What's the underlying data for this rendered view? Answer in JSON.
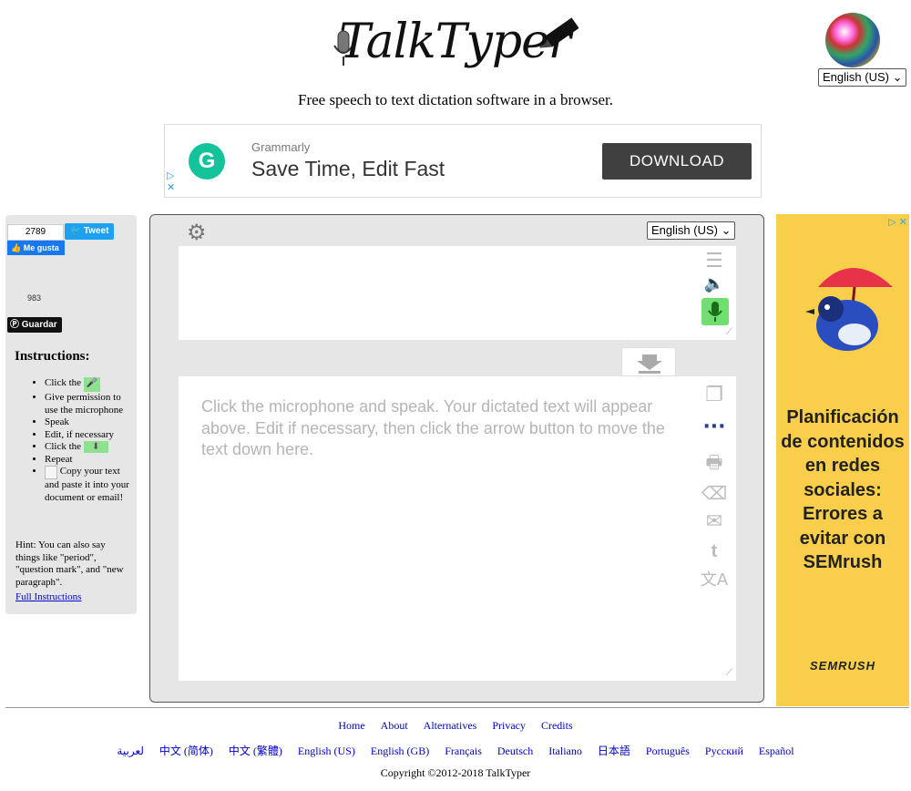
{
  "header": {
    "logo_text": "TalkTyper",
    "tagline": "Free speech to text dictation software in a browser.",
    "ui_language": "English (US)"
  },
  "top_ad": {
    "brand": "Grammarly",
    "headline": "Save Time, Edit Fast",
    "cta": "DOWNLOAD",
    "brand_color": "#15c39a"
  },
  "social": {
    "tweet_count": "2789",
    "tweet_label": "Tweet",
    "like_label": "Me gusta",
    "pin_count": "983",
    "pin_label": "Guardar"
  },
  "instructions": {
    "title": "Instructions:",
    "steps": [
      "Click the",
      "Give permission to use the microphone",
      "Speak",
      "Edit, if necessary",
      "Click the",
      "Repeat",
      "Copy your text and paste it into your document or email!"
    ],
    "hint": "Hint: You can also say things like \"period\", \"question mark\", and \"new paragraph\".",
    "full_link": "Full Instructions"
  },
  "dictation": {
    "language": "English (US)",
    "top_text": "",
    "placeholder": "Click the microphone and speak. Your dictated text will appear above. Edit if necessary, then click the arrow button to move the text down here.",
    "mic_color": "#6fe06f"
  },
  "right_ad": {
    "text": "Planificación de contenidos en redes sociales: Errores a evitar con SEMrush",
    "brand": "SEMRUSH"
  },
  "footer": {
    "nav": [
      "Home",
      "About",
      "Alternatives",
      "Privacy",
      "Credits"
    ],
    "languages": [
      "لعربية",
      "中文 (简体)",
      "中文 (繁體)",
      "English (US)",
      "English (GB)",
      "Français",
      "Deutsch",
      "Italiano",
      "日本語",
      "Português",
      "Русский",
      "Español"
    ],
    "copyright": "Copyright ©2012-2018 TalkTyper"
  }
}
